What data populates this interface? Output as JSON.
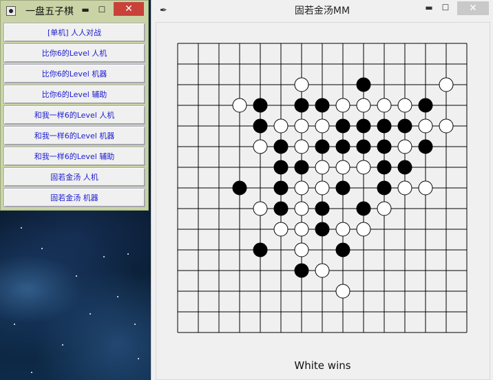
{
  "left_window": {
    "title": "一盘五子棋",
    "modes": [
      "[单机] 人人对战",
      "比你6的Level   人机",
      "比你6的Level  机器",
      "比你6的Level  辅助",
      "和我一样6的Level  人机",
      "和我一样6的Level  机器",
      "和我一样6的Level  辅助",
      "固若金汤   人机",
      "固若金汤  机器"
    ]
  },
  "right_window": {
    "title": "固若金汤MM",
    "status": "White wins"
  },
  "board": {
    "size": 15,
    "black_color": "#000000",
    "white_color": "#ffffff",
    "black": [
      [
        9,
        2
      ],
      [
        4,
        3
      ],
      [
        6,
        3
      ],
      [
        7,
        3
      ],
      [
        12,
        3
      ],
      [
        4,
        4
      ],
      [
        8,
        4
      ],
      [
        9,
        4
      ],
      [
        10,
        4
      ],
      [
        11,
        4
      ],
      [
        5,
        5
      ],
      [
        7,
        5
      ],
      [
        8,
        5
      ],
      [
        9,
        5
      ],
      [
        10,
        5
      ],
      [
        12,
        5
      ],
      [
        5,
        6
      ],
      [
        6,
        6
      ],
      [
        10,
        6
      ],
      [
        11,
        6
      ],
      [
        3,
        7
      ],
      [
        5,
        7
      ],
      [
        8,
        7
      ],
      [
        10,
        7
      ],
      [
        5,
        8
      ],
      [
        7,
        8
      ],
      [
        9,
        8
      ],
      [
        7,
        9
      ],
      [
        4,
        10
      ],
      [
        8,
        10
      ],
      [
        6,
        11
      ]
    ],
    "white": [
      [
        6,
        2
      ],
      [
        13,
        2
      ],
      [
        3,
        3
      ],
      [
        8,
        3
      ],
      [
        9,
        3
      ],
      [
        10,
        3
      ],
      [
        11,
        3
      ],
      [
        5,
        4
      ],
      [
        6,
        4
      ],
      [
        7,
        4
      ],
      [
        12,
        4
      ],
      [
        13,
        4
      ],
      [
        4,
        5
      ],
      [
        6,
        5
      ],
      [
        11,
        5
      ],
      [
        7,
        6
      ],
      [
        8,
        6
      ],
      [
        9,
        6
      ],
      [
        6,
        7
      ],
      [
        7,
        7
      ],
      [
        11,
        7
      ],
      [
        12,
        7
      ],
      [
        4,
        8
      ],
      [
        6,
        8
      ],
      [
        10,
        8
      ],
      [
        5,
        9
      ],
      [
        6,
        9
      ],
      [
        8,
        9
      ],
      [
        9,
        9
      ],
      [
        6,
        10
      ],
      [
        7,
        11
      ],
      [
        8,
        12
      ]
    ]
  }
}
